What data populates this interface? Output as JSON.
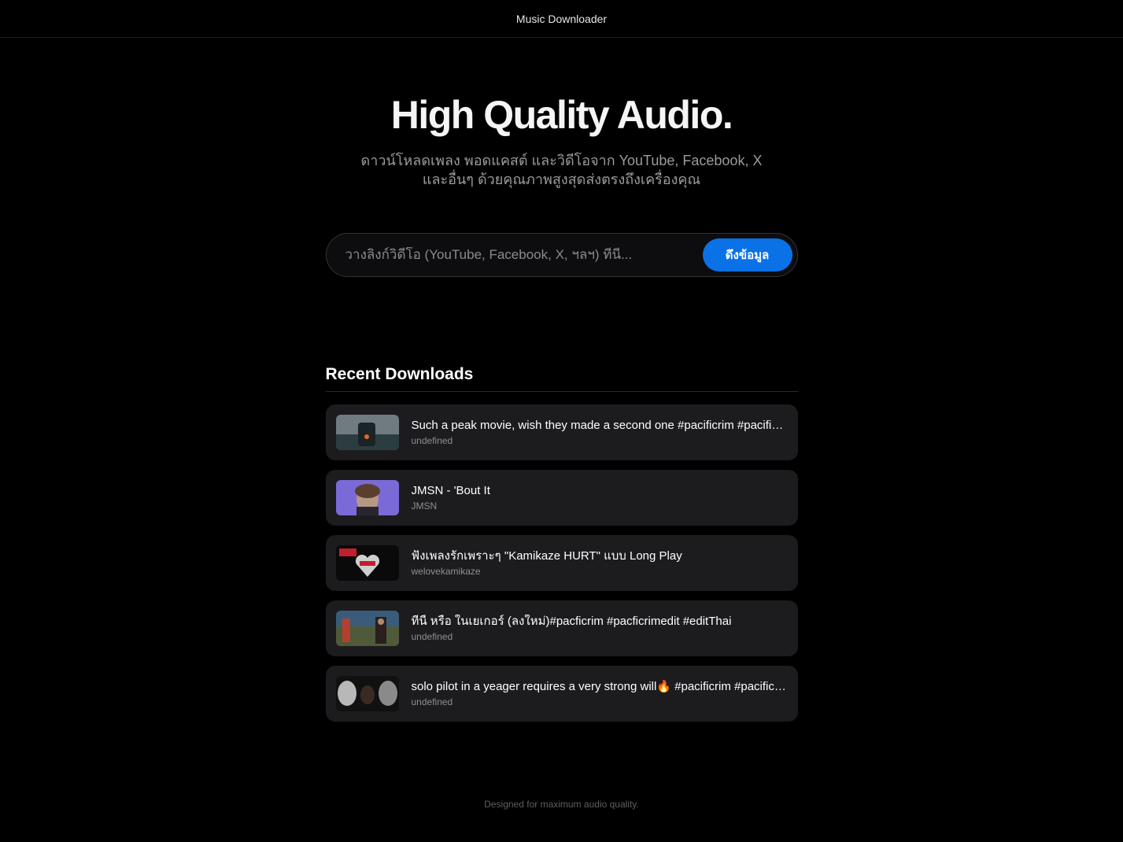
{
  "header": {
    "title": "Music Downloader"
  },
  "hero": {
    "title": "High Quality Audio.",
    "subtitle": "ดาวน์โหลดเพลง พอดแคสต์ และวิดีโอจาก YouTube, Facebook, X และอื่นๆ ด้วยคุณภาพสูงสุดส่งตรงถึงเครื่องคุณ"
  },
  "search": {
    "placeholder": "วางลิงก์วิดีโอ (YouTube, Facebook, X, ฯลฯ) ที่นี่...",
    "value": "",
    "button_label": "ดึงข้อมูล"
  },
  "recent": {
    "heading": "Recent Downloads",
    "items": [
      {
        "title": "Such a peak movie, wish they made a second one #pacificrim #pacificrimuprising",
        "subtitle": "undefined",
        "thumb_colors": [
          "#6f7b80",
          "#2c3d3f"
        ]
      },
      {
        "title": "JMSN - 'Bout It",
        "subtitle": "JMSN",
        "thumb_colors": [
          "#7a6ad8",
          "#b49a84"
        ]
      },
      {
        "title": "ฟังเพลงรักเพราะๆ \"Kamikaze HURT\" แบบ Long Play",
        "subtitle": "welovekamikaze",
        "thumb_colors": [
          "#0a0a0a",
          "#c21f2e"
        ]
      },
      {
        "title": "ที่นี้ หรือ ในเยเกอร์ (ลงใหม่)#pacficrim #pacficrimedit #editThai",
        "subtitle": "undefined",
        "thumb_colors": [
          "#3a5c7a",
          "#b3402e"
        ]
      },
      {
        "title": "solo pilot in a yeager requires a very strong will🔥 #pacificrim #pacificrimuprising",
        "subtitle": "undefined",
        "thumb_colors": [
          "#111111",
          "#b8b8b8"
        ]
      }
    ]
  },
  "footer": {
    "text": "Designed for maximum audio quality."
  }
}
